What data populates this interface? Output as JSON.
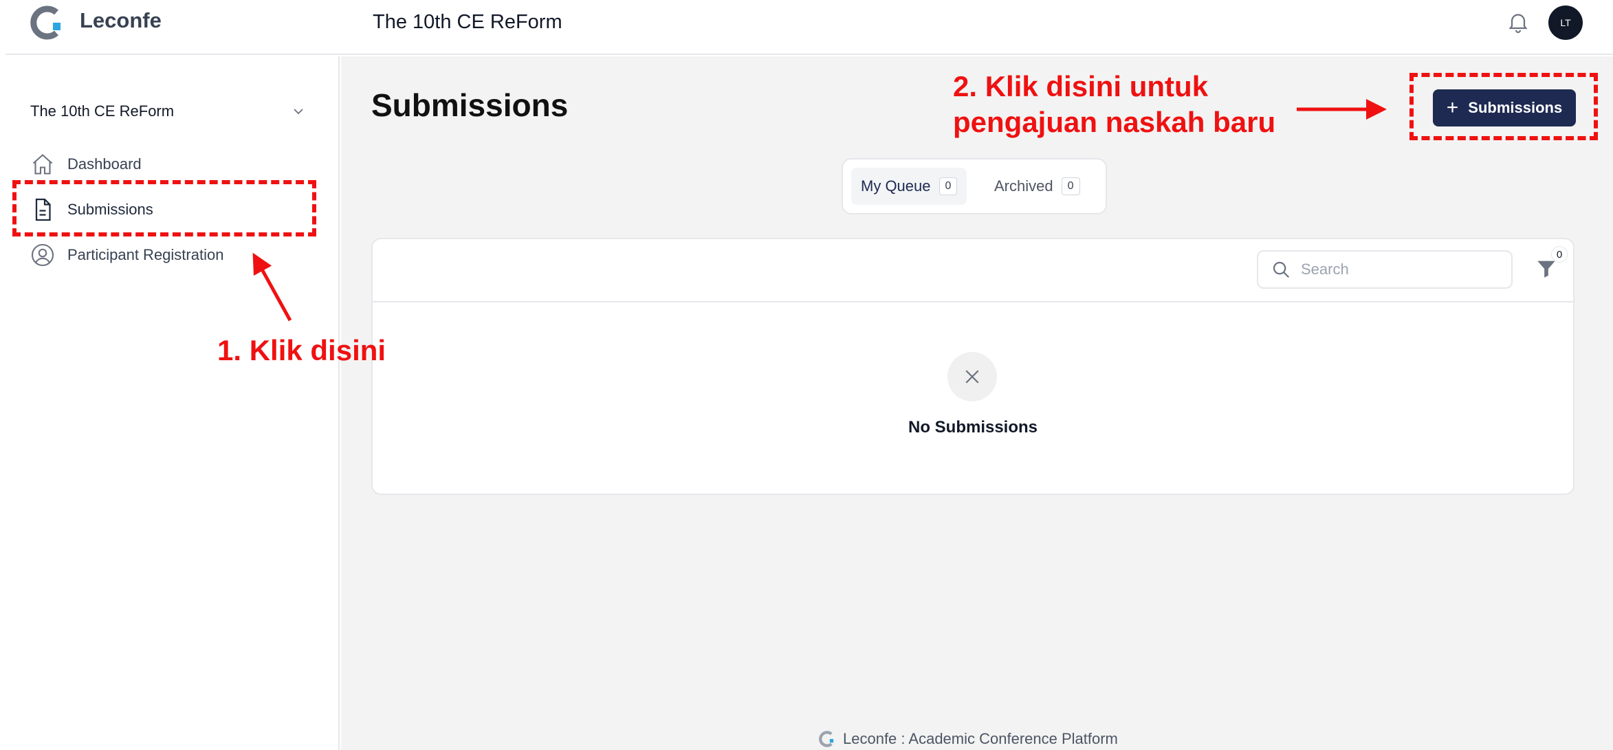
{
  "app": {
    "logo_text": "Leconfe",
    "header_title": "The 10th CE ReForm",
    "avatar_initials": "LT"
  },
  "sidebar": {
    "conference_selector": "The 10th CE ReForm",
    "items": [
      {
        "label": "Dashboard",
        "icon": "home-icon"
      },
      {
        "label": "Submissions",
        "icon": "document-icon",
        "active": true
      },
      {
        "label": "Participant Registration",
        "icon": "user-circle-icon"
      }
    ]
  },
  "main": {
    "page_title": "Submissions",
    "new_button_label": "Submissions",
    "tabs": [
      {
        "label": "My Queue",
        "count": "0",
        "active": true
      },
      {
        "label": "Archived",
        "count": "0",
        "active": false
      }
    ],
    "search_placeholder": "Search",
    "filter_count": "0",
    "empty_text": "No Submissions"
  },
  "footer": {
    "text": "Leconfe : Academic Conference Platform"
  },
  "annotations": {
    "step1": "1. Klik disini",
    "step2_line1": "2. Klik disini untuk",
    "step2_line2": "pengajuan naskah baru",
    "color": "#ef1111"
  },
  "colors": {
    "primary": "#1e2a52",
    "background": "#f3f3f3"
  }
}
